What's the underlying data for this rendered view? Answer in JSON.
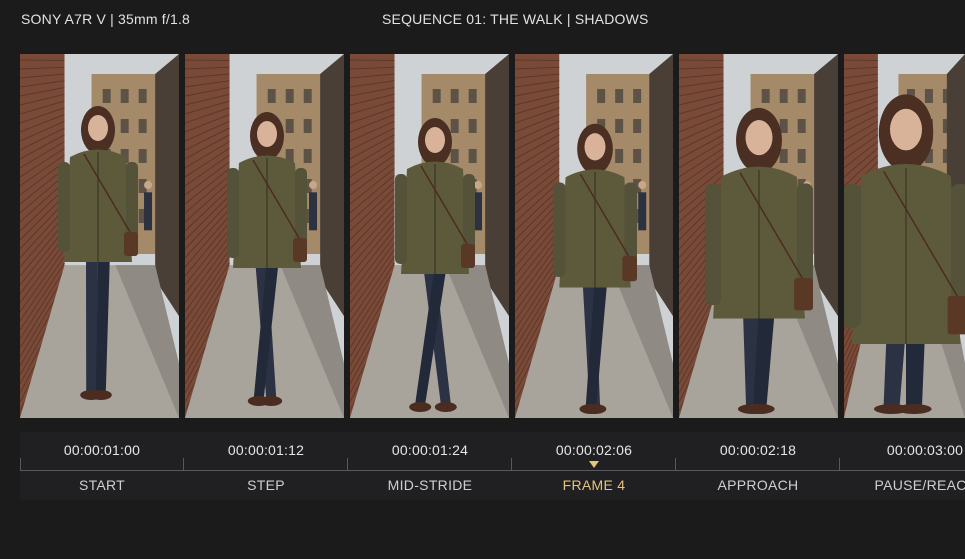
{
  "header": {
    "camera": "SONY A7R V | 35mm f/1.8",
    "sequence": "SEQUENCE 01: THE WALK | SHADOWS"
  },
  "frames": [
    {
      "timecode": "00:00:01:00",
      "label": "START"
    },
    {
      "timecode": "00:00:01:12",
      "label": "STEP"
    },
    {
      "timecode": "00:00:01:24",
      "label": "MID-STRIDE"
    },
    {
      "timecode": "00:00:02:06",
      "label": "FRAME 4"
    },
    {
      "timecode": "00:00:02:18",
      "label": "APPROACH"
    },
    {
      "timecode": "00:00:03:00",
      "label": "PAUSE/REACT"
    }
  ],
  "selected_frame": 3,
  "colors": {
    "background": "#1b1b1c",
    "timeline": "#202022",
    "accent": "#e6c27a",
    "brick": "#7a4a38",
    "pavement": "#a8a39b",
    "jacket": "#5d5a3c",
    "jeans": "#2a3244",
    "hair": "#4a2f22"
  }
}
